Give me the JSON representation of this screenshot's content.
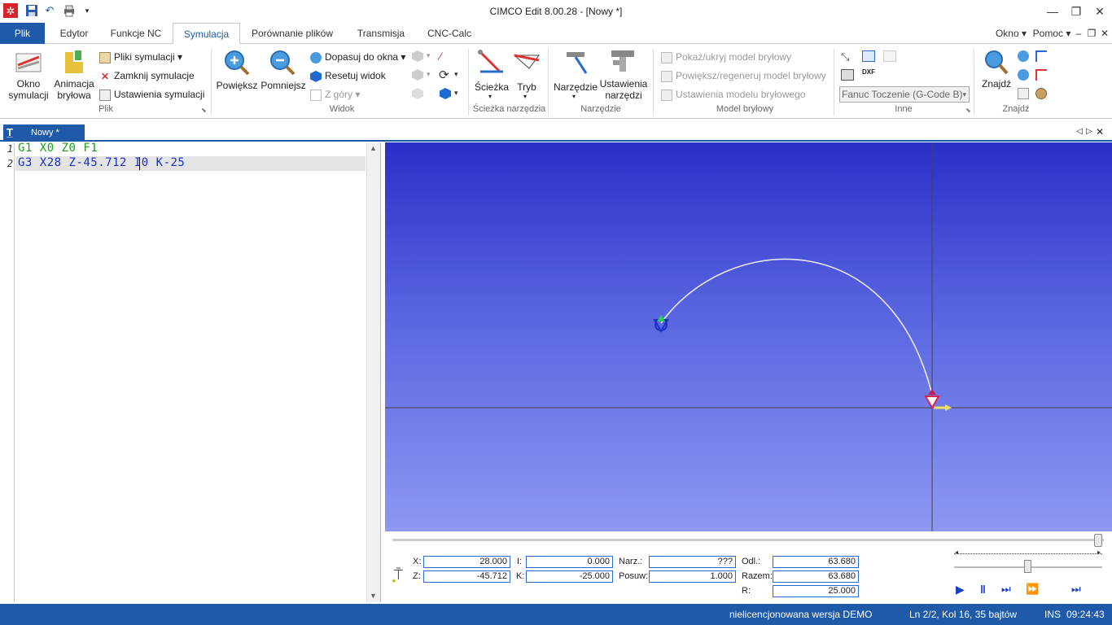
{
  "window": {
    "title": "CIMCO Edit 8.00.28 - [Nowy *]"
  },
  "menu_right": {
    "okno": "Okno",
    "pomoc": "Pomoc"
  },
  "tabs": [
    "Plik",
    "Edytor",
    "Funkcje NC",
    "Symulacja",
    "Porównanie plików",
    "Transmisja",
    "CNC-Calc"
  ],
  "ribbon": {
    "plik": {
      "okno_symulacji": [
        "Okno",
        "symulacji"
      ],
      "animacja": [
        "Animacja",
        "bryłowa"
      ],
      "pliki_symulacji": "Pliki symulacji",
      "zamknij_symulacje": "Zamknij symulacje",
      "ustawienia_symulacji": "Ustawienia symulacji",
      "group": "Plik"
    },
    "widok": {
      "powieksz": "Powiększ",
      "pomniejsz": "Pomniejsz",
      "dopasuj": "Dopasuj do okna",
      "resetuj": "Resetuj widok",
      "z_gory": "Z góry",
      "group": "Widok"
    },
    "sciezka": {
      "sciezka": "Ścieżka",
      "tryb": "Tryb",
      "group": "Ścieżka narzędzia"
    },
    "narzedzie": {
      "narzedzie": "Narzędzie",
      "ustawienia": [
        "Ustawienia",
        "narzędzi"
      ],
      "group": "Narzędzie"
    },
    "model": {
      "pokaz": "Pokaż/ukryj model bryłowy",
      "powieksz": "Powiększ/regeneruj model bryłowy",
      "ustawienia": "Ustawienia modelu bryłowego",
      "group": "Model bryłowy"
    },
    "inne": {
      "machine": "Fanuc Toczenie (G-Code B)",
      "dxf": "DXF",
      "group": "Inne"
    },
    "znajdz": {
      "znajdz": "Znajdź",
      "group": "Znajdź"
    }
  },
  "doc_tab": "Nowy *",
  "editor": {
    "lines": [
      {
        "num": "1",
        "text": "G1 X0 Z0 F1"
      },
      {
        "num": "2",
        "text": "G3 X28 Z-45.712 I0 K-25"
      }
    ]
  },
  "panel": {
    "x_label": "X:",
    "x_val": "28.000",
    "z_label": "Z:",
    "z_val": "-45.712",
    "i_label": "I:",
    "i_val": "0.000",
    "k_label": "K:",
    "k_val": "-25.000",
    "narz_label": "Narz.:",
    "narz_val": "???",
    "posuw_label": "Posuw:",
    "posuw_val": "1.000",
    "odl_label": "Odl.:",
    "odl_val": "63.680",
    "razem_label": "Razem:",
    "razem_val": "63.680",
    "r_label": "R:",
    "r_val": "25.000"
  },
  "status": {
    "license": "nielicencjonowana wersja DEMO",
    "position": "Ln 2/2, Kol 16, 35 bajtów",
    "mode": "INS",
    "time": "09:24:43"
  },
  "colors": {
    "accent": "#1e5aa8",
    "code_g1": "#1a9e1a",
    "code_g3": "#1a2ec8"
  }
}
